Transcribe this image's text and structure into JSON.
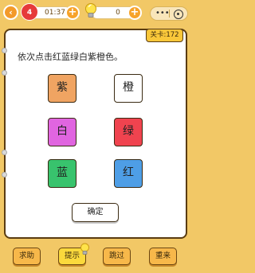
{
  "header": {
    "lives": "4",
    "timer": "01:37",
    "coins": "0",
    "add_symbol": "+",
    "back_symbol": "‹",
    "menu_dots": "•••",
    "level_label": "关卡:172"
  },
  "question": "依次点击红蓝绿白紫橙色。",
  "options": [
    {
      "label": "紫",
      "fill": "#f0a462"
    },
    {
      "label": "橙",
      "fill": "#ffffff"
    },
    {
      "label": "白",
      "fill": "#e065e0"
    },
    {
      "label": "绿",
      "fill": "#f0434f"
    },
    {
      "label": "蓝",
      "fill": "#38c36d"
    },
    {
      "label": "红",
      "fill": "#4e9ee6"
    }
  ],
  "confirm_label": "确定",
  "bottom": {
    "help_label": "求助",
    "hint_label": "提示",
    "skip_label": "跳过",
    "restart_label": "重来"
  },
  "colors": {
    "background": "#f2c866",
    "card": "#ffffff",
    "accent": "#f7a32a",
    "level_badge": "#f9c73a"
  }
}
